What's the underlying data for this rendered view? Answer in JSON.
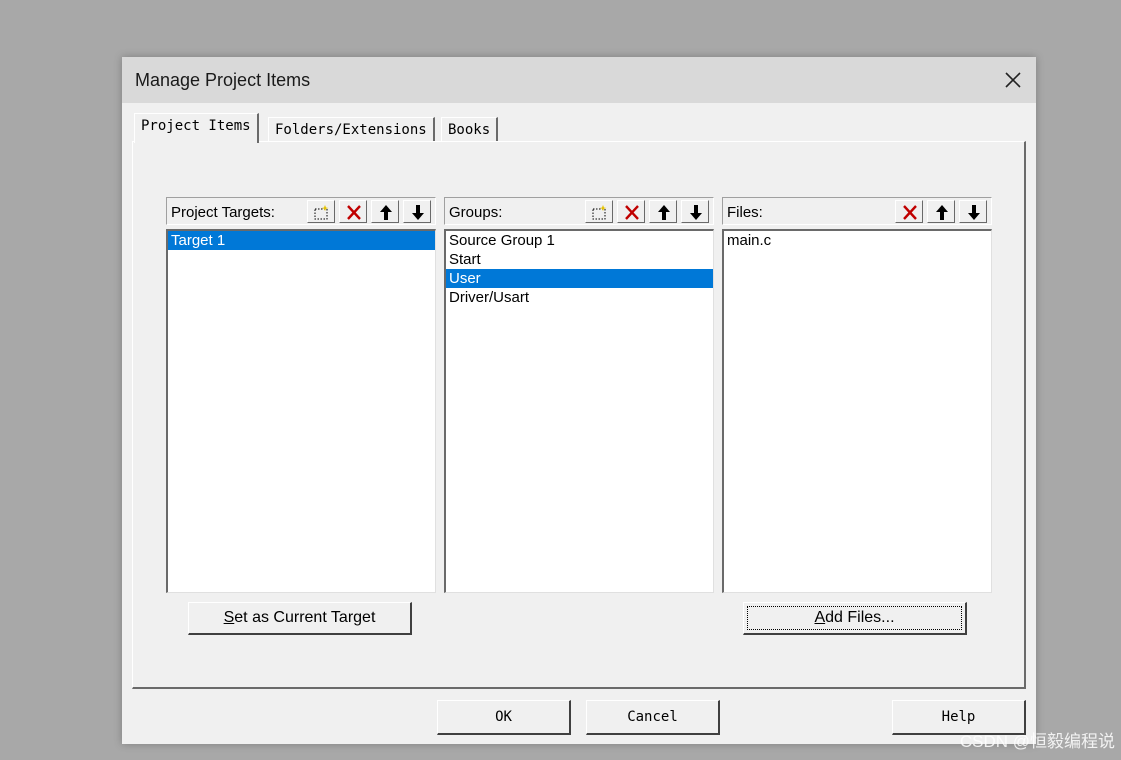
{
  "dialog": {
    "title": "Manage Project Items"
  },
  "tabs": [
    {
      "label": "Project Items",
      "active": true
    },
    {
      "label": "Folders/Extensions",
      "active": false
    },
    {
      "label": "Books",
      "active": false
    }
  ],
  "targets_pane": {
    "label": "Project Targets:",
    "items": [
      "Target 1"
    ],
    "selected_index": 0,
    "button_prefix": "S",
    "button_rest": "et as Current Target"
  },
  "groups_pane": {
    "label": "Groups:",
    "items": [
      "Source Group 1",
      "Start",
      "User",
      "Driver/Usart"
    ],
    "selected_index": 2
  },
  "files_pane": {
    "label": "Files:",
    "items": [
      "main.c"
    ],
    "button_prefix": "A",
    "button_rest": "dd Files..."
  },
  "footer": {
    "ok_label": "OK",
    "cancel_label": "Cancel",
    "help_label": "Help"
  },
  "watermark": "CSDN @恒毅编程说",
  "colors": {
    "selection": "#0078d7",
    "delete_icon": "#c00000",
    "title_bar": "#d9d9d9"
  },
  "icons": [
    "close-icon",
    "new-item-icon",
    "delete-icon",
    "move-up-icon",
    "move-down-icon"
  ]
}
